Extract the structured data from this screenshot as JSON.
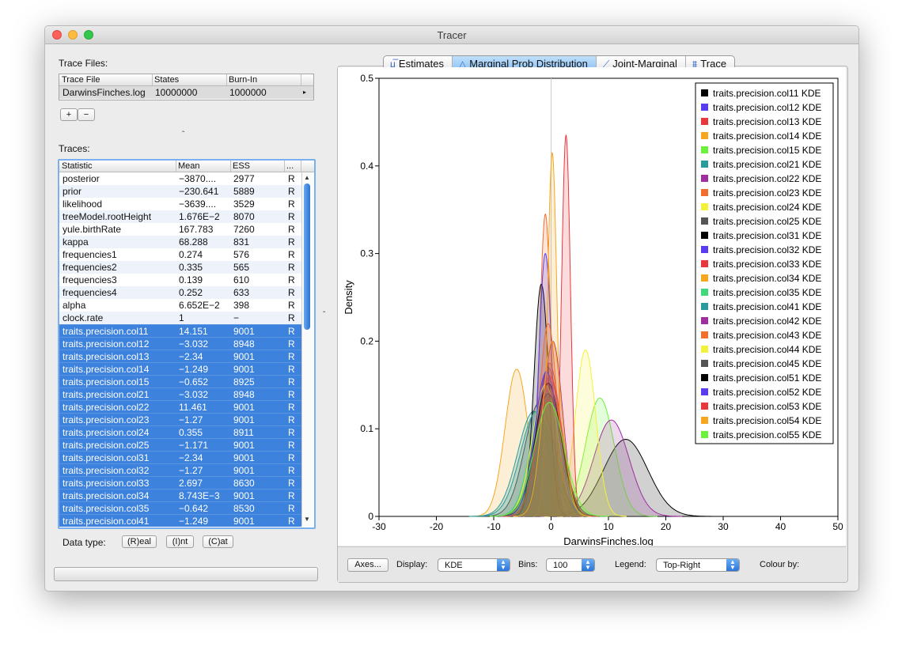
{
  "window": {
    "title": "Tracer"
  },
  "trace_files": {
    "label": "Trace Files:",
    "columns": [
      "Trace File",
      "States",
      "Burn-In"
    ],
    "rows": [
      {
        "file": "DarwinsFinches.log",
        "states": "10000000",
        "burnin": "1000000"
      }
    ],
    "add_label": "+",
    "remove_label": "−"
  },
  "traces": {
    "label": "Traces:",
    "columns": [
      "Statistic",
      "Mean",
      "ESS",
      "..."
    ],
    "rows": [
      {
        "stat": "posterior",
        "mean": "−3870....",
        "ess": "2977",
        "type": "R",
        "selected": false
      },
      {
        "stat": "prior",
        "mean": "−230.641",
        "ess": "5889",
        "type": "R",
        "selected": false
      },
      {
        "stat": "likelihood",
        "mean": "−3639....",
        "ess": "3529",
        "type": "R",
        "selected": false
      },
      {
        "stat": "treeModel.rootHeight",
        "mean": "1.676E−2",
        "ess": "8070",
        "type": "R",
        "selected": false
      },
      {
        "stat": "yule.birthRate",
        "mean": "167.783",
        "ess": "7260",
        "type": "R",
        "selected": false
      },
      {
        "stat": "kappa",
        "mean": "68.288",
        "ess": "831",
        "type": "R",
        "selected": false
      },
      {
        "stat": "frequencies1",
        "mean": "0.274",
        "ess": "576",
        "type": "R",
        "selected": false
      },
      {
        "stat": "frequencies2",
        "mean": "0.335",
        "ess": "565",
        "type": "R",
        "selected": false
      },
      {
        "stat": "frequencies3",
        "mean": "0.139",
        "ess": "610",
        "type": "R",
        "selected": false
      },
      {
        "stat": "frequencies4",
        "mean": "0.252",
        "ess": "633",
        "type": "R",
        "selected": false
      },
      {
        "stat": "alpha",
        "mean": "6.652E−2",
        "ess": "398",
        "type": "R",
        "selected": false
      },
      {
        "stat": "clock.rate",
        "mean": "1",
        "ess": "−",
        "type": "R",
        "selected": false
      },
      {
        "stat": "traits.precision.col11",
        "mean": "14.151",
        "ess": "9001",
        "type": "R",
        "selected": true
      },
      {
        "stat": "traits.precision.col12",
        "mean": "−3.032",
        "ess": "8948",
        "type": "R",
        "selected": true
      },
      {
        "stat": "traits.precision.col13",
        "mean": "−2.34",
        "ess": "9001",
        "type": "R",
        "selected": true
      },
      {
        "stat": "traits.precision.col14",
        "mean": "−1.249",
        "ess": "9001",
        "type": "R",
        "selected": true
      },
      {
        "stat": "traits.precision.col15",
        "mean": "−0.652",
        "ess": "8925",
        "type": "R",
        "selected": true
      },
      {
        "stat": "traits.precision.col21",
        "mean": "−3.032",
        "ess": "8948",
        "type": "R",
        "selected": true
      },
      {
        "stat": "traits.precision.col22",
        "mean": "11.461",
        "ess": "9001",
        "type": "R",
        "selected": true
      },
      {
        "stat": "traits.precision.col23",
        "mean": "−1.27",
        "ess": "9001",
        "type": "R",
        "selected": true
      },
      {
        "stat": "traits.precision.col24",
        "mean": "0.355",
        "ess": "8911",
        "type": "R",
        "selected": true
      },
      {
        "stat": "traits.precision.col25",
        "mean": "−1.171",
        "ess": "9001",
        "type": "R",
        "selected": true
      },
      {
        "stat": "traits.precision.col31",
        "mean": "−2.34",
        "ess": "9001",
        "type": "R",
        "selected": true
      },
      {
        "stat": "traits.precision.col32",
        "mean": "−1.27",
        "ess": "9001",
        "type": "R",
        "selected": true
      },
      {
        "stat": "traits.precision.col33",
        "mean": "2.697",
        "ess": "8630",
        "type": "R",
        "selected": true
      },
      {
        "stat": "traits.precision.col34",
        "mean": "8.743E−3",
        "ess": "9001",
        "type": "R",
        "selected": true
      },
      {
        "stat": "traits.precision.col35",
        "mean": "−0.642",
        "ess": "8530",
        "type": "R",
        "selected": true
      },
      {
        "stat": "traits.precision.col41",
        "mean": "−1.249",
        "ess": "9001",
        "type": "R",
        "selected": true
      }
    ]
  },
  "data_type": {
    "label": "Data type:",
    "buttons": [
      "(R)eal",
      "(I)nt",
      "(C)at"
    ]
  },
  "tabs": [
    {
      "label": "Estimates",
      "icon": "mu-icon",
      "active": false
    },
    {
      "label": "Marginal Prob Distribution",
      "icon": "triangle-icon",
      "active": true
    },
    {
      "label": "Joint-Marginal",
      "icon": "scatter-icon",
      "active": false
    },
    {
      "label": "Trace",
      "icon": "trace-icon",
      "active": false
    }
  ],
  "bottom": {
    "axes_label": "Axes...",
    "display_label": "Display:",
    "display_value": "KDE",
    "bins_label": "Bins:",
    "bins_value": "100",
    "legend_label": "Legend:",
    "legend_value": "Top-Right",
    "colour_label": "Colour by:"
  },
  "chart_data": {
    "type": "area",
    "xlabel": "DarwinsFinches.log",
    "ylabel": "Density",
    "xlim": [
      -30,
      50
    ],
    "ylim": [
      0,
      0.5
    ],
    "xticks": [
      -30,
      -20,
      -10,
      0,
      10,
      20,
      30,
      40,
      50
    ],
    "yticks": [
      0,
      0.1,
      0.2,
      0.3,
      0.4,
      0.5
    ],
    "legend_position": "top-right",
    "vline_x": 0,
    "series": [
      {
        "name": "traits.precision.col11 KDE",
        "color": "#000000",
        "mean": 13,
        "peak": 0.088
      },
      {
        "name": "traits.precision.col12 KDE",
        "color": "#5a3cf0",
        "mean": -0.5,
        "peak": 0.17
      },
      {
        "name": "traits.precision.col13 KDE",
        "color": "#e8383c",
        "mean": -0.3,
        "peak": 0.175
      },
      {
        "name": "traits.precision.col14 KDE",
        "color": "#f6a71e",
        "mean": -6,
        "peak": 0.168
      },
      {
        "name": "traits.precision.col15 KDE",
        "color": "#6cf23a",
        "mean": 8.5,
        "peak": 0.135
      },
      {
        "name": "traits.precision.col21 KDE",
        "color": "#2a9b9b",
        "mean": -3,
        "peak": 0.12
      },
      {
        "name": "traits.precision.col22 KDE",
        "color": "#9d2fa0",
        "mean": 10.5,
        "peak": 0.11
      },
      {
        "name": "traits.precision.col23 KDE",
        "color": "#f26e2c",
        "mean": -1,
        "peak": 0.345
      },
      {
        "name": "traits.precision.col24 KDE",
        "color": "#f2f23a",
        "mean": 6,
        "peak": 0.19
      },
      {
        "name": "traits.precision.col25 KDE",
        "color": "#555555",
        "mean": -2,
        "peak": 0.13
      },
      {
        "name": "traits.precision.col31 KDE",
        "color": "#000000",
        "mean": -1.7,
        "peak": 0.265
      },
      {
        "name": "traits.precision.col32 KDE",
        "color": "#5a3cf0",
        "mean": -1,
        "peak": 0.3
      },
      {
        "name": "traits.precision.col33 KDE",
        "color": "#e8383c",
        "mean": 2.6,
        "peak": 0.435
      },
      {
        "name": "traits.precision.col34 KDE",
        "color": "#f6a71e",
        "mean": 0.2,
        "peak": 0.415
      },
      {
        "name": "traits.precision.col35 KDE",
        "color": "#3ed97a",
        "mean": -1,
        "peak": 0.14
      },
      {
        "name": "traits.precision.col41 KDE",
        "color": "#2a9b9b",
        "mean": -2.5,
        "peak": 0.12
      },
      {
        "name": "traits.precision.col42 KDE",
        "color": "#9d2fa0",
        "mean": 0.3,
        "peak": 0.2
      },
      {
        "name": "traits.precision.col43 KDE",
        "color": "#f26e2c",
        "mean": -0.5,
        "peak": 0.22
      },
      {
        "name": "traits.precision.col44 KDE",
        "color": "#f2f23a",
        "mean": -1,
        "peak": 0.15
      },
      {
        "name": "traits.precision.col45 KDE",
        "color": "#555555",
        "mean": -0.5,
        "peak": 0.14
      },
      {
        "name": "traits.precision.col51 KDE",
        "color": "#000000",
        "mean": -0.5,
        "peak": 0.152
      },
      {
        "name": "traits.precision.col52 KDE",
        "color": "#5a3cf0",
        "mean": -0.8,
        "peak": 0.165
      },
      {
        "name": "traits.precision.col53 KDE",
        "color": "#e8383c",
        "mean": -0.2,
        "peak": 0.16
      },
      {
        "name": "traits.precision.col54 KDE",
        "color": "#f6a71e",
        "mean": 0.2,
        "peak": 0.2
      },
      {
        "name": "traits.precision.col55 KDE",
        "color": "#6cf23a",
        "mean": -0.3,
        "peak": 0.13
      }
    ]
  }
}
